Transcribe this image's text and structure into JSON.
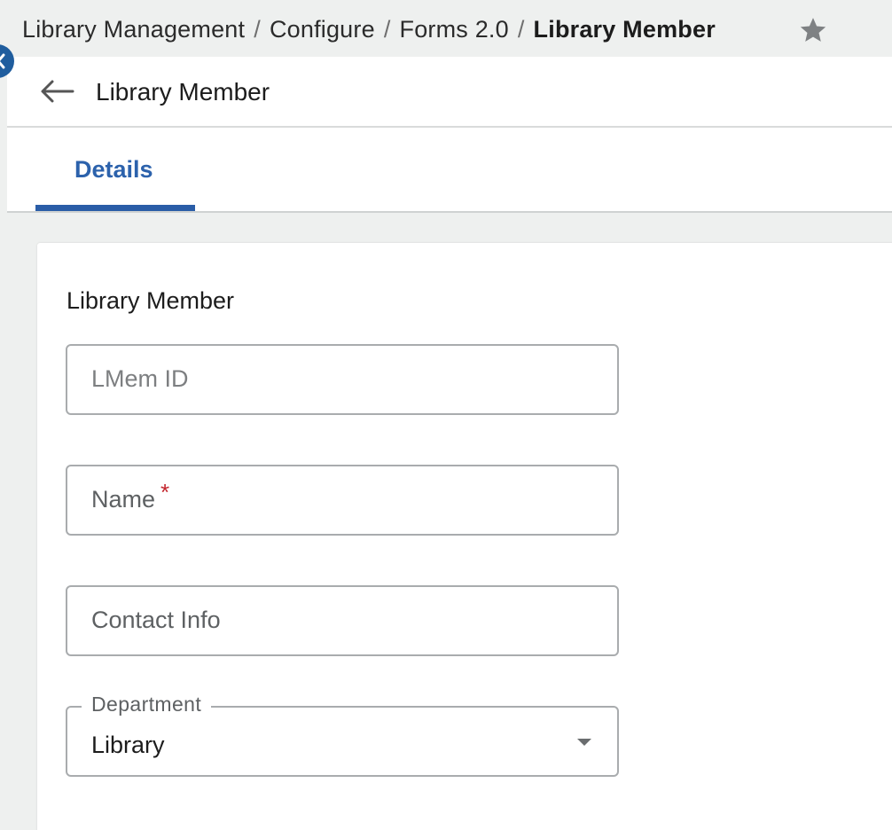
{
  "breadcrumb": {
    "items": [
      "Library Management",
      "Configure",
      "Forms 2.0"
    ],
    "current": "Library Member",
    "separator": "/"
  },
  "header": {
    "title": "Library Member",
    "favorite_icon": "star-icon",
    "back_icon": "back-arrow-icon"
  },
  "tabs": [
    {
      "label": "Details",
      "active": true
    }
  ],
  "form": {
    "section_title": "Library Member",
    "fields": {
      "lmem_id": {
        "placeholder": "LMem ID"
      },
      "name": {
        "placeholder": "Name",
        "required_mark": "*"
      },
      "contact_info": {
        "placeholder": "Contact Info"
      },
      "department": {
        "label": "Department",
        "value": "Library"
      }
    }
  },
  "colors": {
    "accent": "#2a5da7",
    "required": "#c4262e",
    "background": "#eef0ef"
  }
}
